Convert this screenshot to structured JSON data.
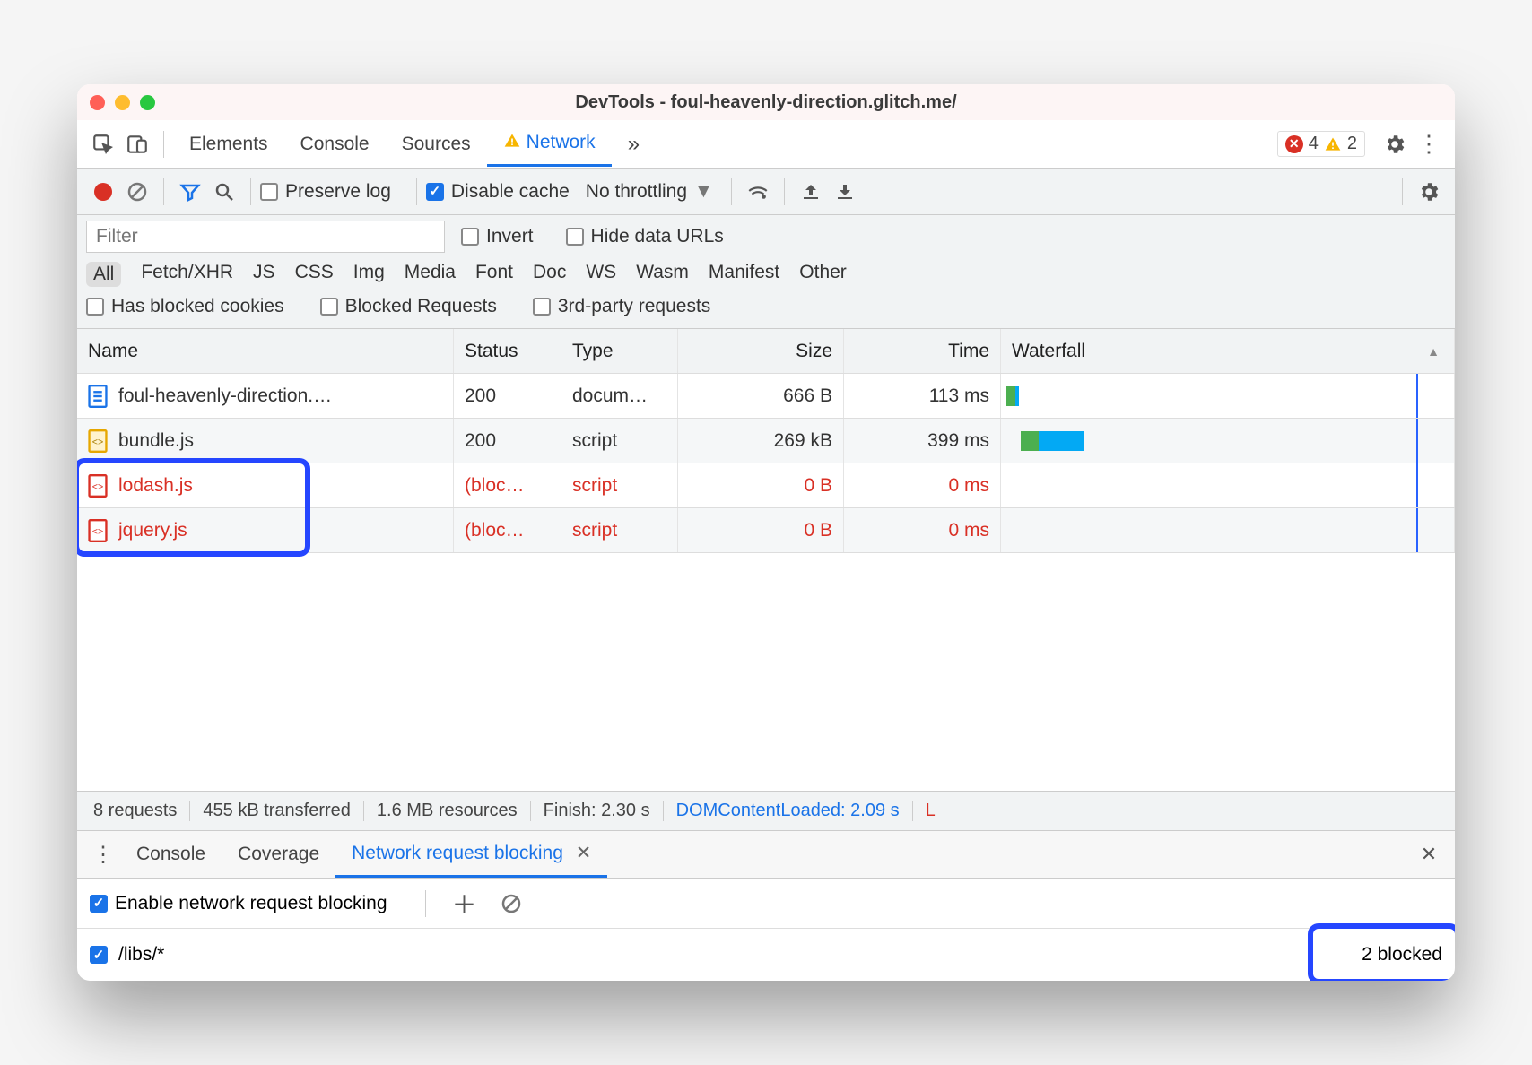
{
  "window": {
    "title": "DevTools - foul-heavenly-direction.glitch.me/"
  },
  "tabs": {
    "items": [
      "Elements",
      "Console",
      "Sources",
      "Network"
    ],
    "active": "Network",
    "overflow": "»"
  },
  "counts": {
    "errors": "4",
    "warnings": "2"
  },
  "toolbar": {
    "preserve_log": "Preserve log",
    "disable_cache": "Disable cache",
    "throttling": "No throttling"
  },
  "filter": {
    "placeholder": "Filter",
    "invert": "Invert",
    "hide_data_urls": "Hide data URLs",
    "types": [
      "All",
      "Fetch/XHR",
      "JS",
      "CSS",
      "Img",
      "Media",
      "Font",
      "Doc",
      "WS",
      "Wasm",
      "Manifest",
      "Other"
    ],
    "has_blocked_cookies": "Has blocked cookies",
    "blocked_requests": "Blocked Requests",
    "third_party": "3rd-party requests"
  },
  "columns": {
    "name": "Name",
    "status": "Status",
    "type": "Type",
    "size": "Size",
    "time": "Time",
    "waterfall": "Waterfall"
  },
  "rows": [
    {
      "name": "foul-heavenly-direction.…",
      "status": "200",
      "type": "docum…",
      "size": "666 B",
      "time": "113 ms",
      "blocked": false,
      "icon": "doc"
    },
    {
      "name": "bundle.js",
      "status": "200",
      "type": "script",
      "size": "269 kB",
      "time": "399 ms",
      "blocked": false,
      "icon": "js"
    },
    {
      "name": "lodash.js",
      "status": "(bloc…",
      "type": "script",
      "size": "0 B",
      "time": "0 ms",
      "blocked": true,
      "icon": "js-red"
    },
    {
      "name": "jquery.js",
      "status": "(bloc…",
      "type": "script",
      "size": "0 B",
      "time": "0 ms",
      "blocked": true,
      "icon": "js-red"
    }
  ],
  "status": {
    "requests": "8 requests",
    "transferred": "455 kB transferred",
    "resources": "1.6 MB resources",
    "finish": "Finish: 2.30 s",
    "dcl": "DOMContentLoaded: 2.09 s",
    "load": "L"
  },
  "drawer": {
    "tabs": [
      "Console",
      "Coverage",
      "Network request blocking"
    ],
    "active": "Network request blocking",
    "enable_label": "Enable network request blocking",
    "pattern": "/libs/*",
    "blocked_count": "2 blocked"
  }
}
